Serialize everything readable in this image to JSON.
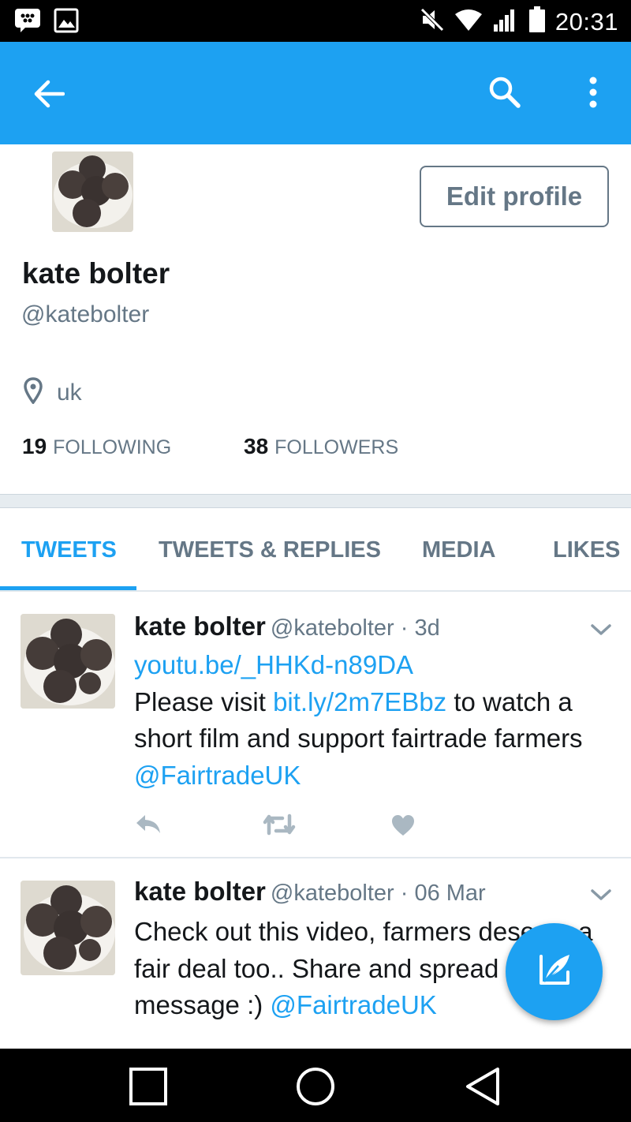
{
  "status_bar": {
    "time": "20:31",
    "icons": [
      "bbm-icon",
      "gallery-icon",
      "mute-icon",
      "wifi-icon",
      "signal-icon",
      "battery-icon"
    ]
  },
  "app_bar": {
    "color": "#1da1f2",
    "icons": [
      "back-arrow-icon",
      "search-icon",
      "more-vertical-icon"
    ]
  },
  "profile": {
    "name": "kate bolter",
    "handle": "@katebolter",
    "location": "uk",
    "edit_button": "Edit profile",
    "following_count": "19",
    "following_label": "FOLLOWING",
    "followers_count": "38",
    "followers_label": "FOLLOWERS"
  },
  "tabs": [
    {
      "label": "TWEETS",
      "active": true
    },
    {
      "label": "TWEETS & REPLIES",
      "active": false
    },
    {
      "label": "MEDIA",
      "active": false
    },
    {
      "label": "LIKES",
      "active": false
    }
  ],
  "tweets": [
    {
      "name": "kate bolter",
      "meta": "@katebolter · 3d",
      "link1": "youtu.be/_HHKd-n89DA",
      "text_a": "Please visit ",
      "link2": "bit.ly/2m7EBbz",
      "text_b": " to watch a short film and support fairtrade farmers ",
      "mention": "@FairtradeUK"
    },
    {
      "name": "kate bolter",
      "meta": "@katebolter · 06 Mar",
      "text_a": "Check out this video, farmers deserve a fair deal too.. Share and spread the message :) ",
      "mention": "@FairtradeUK"
    }
  ],
  "colors": {
    "accent": "#1da1f2",
    "muted": "#657786",
    "text": "#14171a"
  }
}
